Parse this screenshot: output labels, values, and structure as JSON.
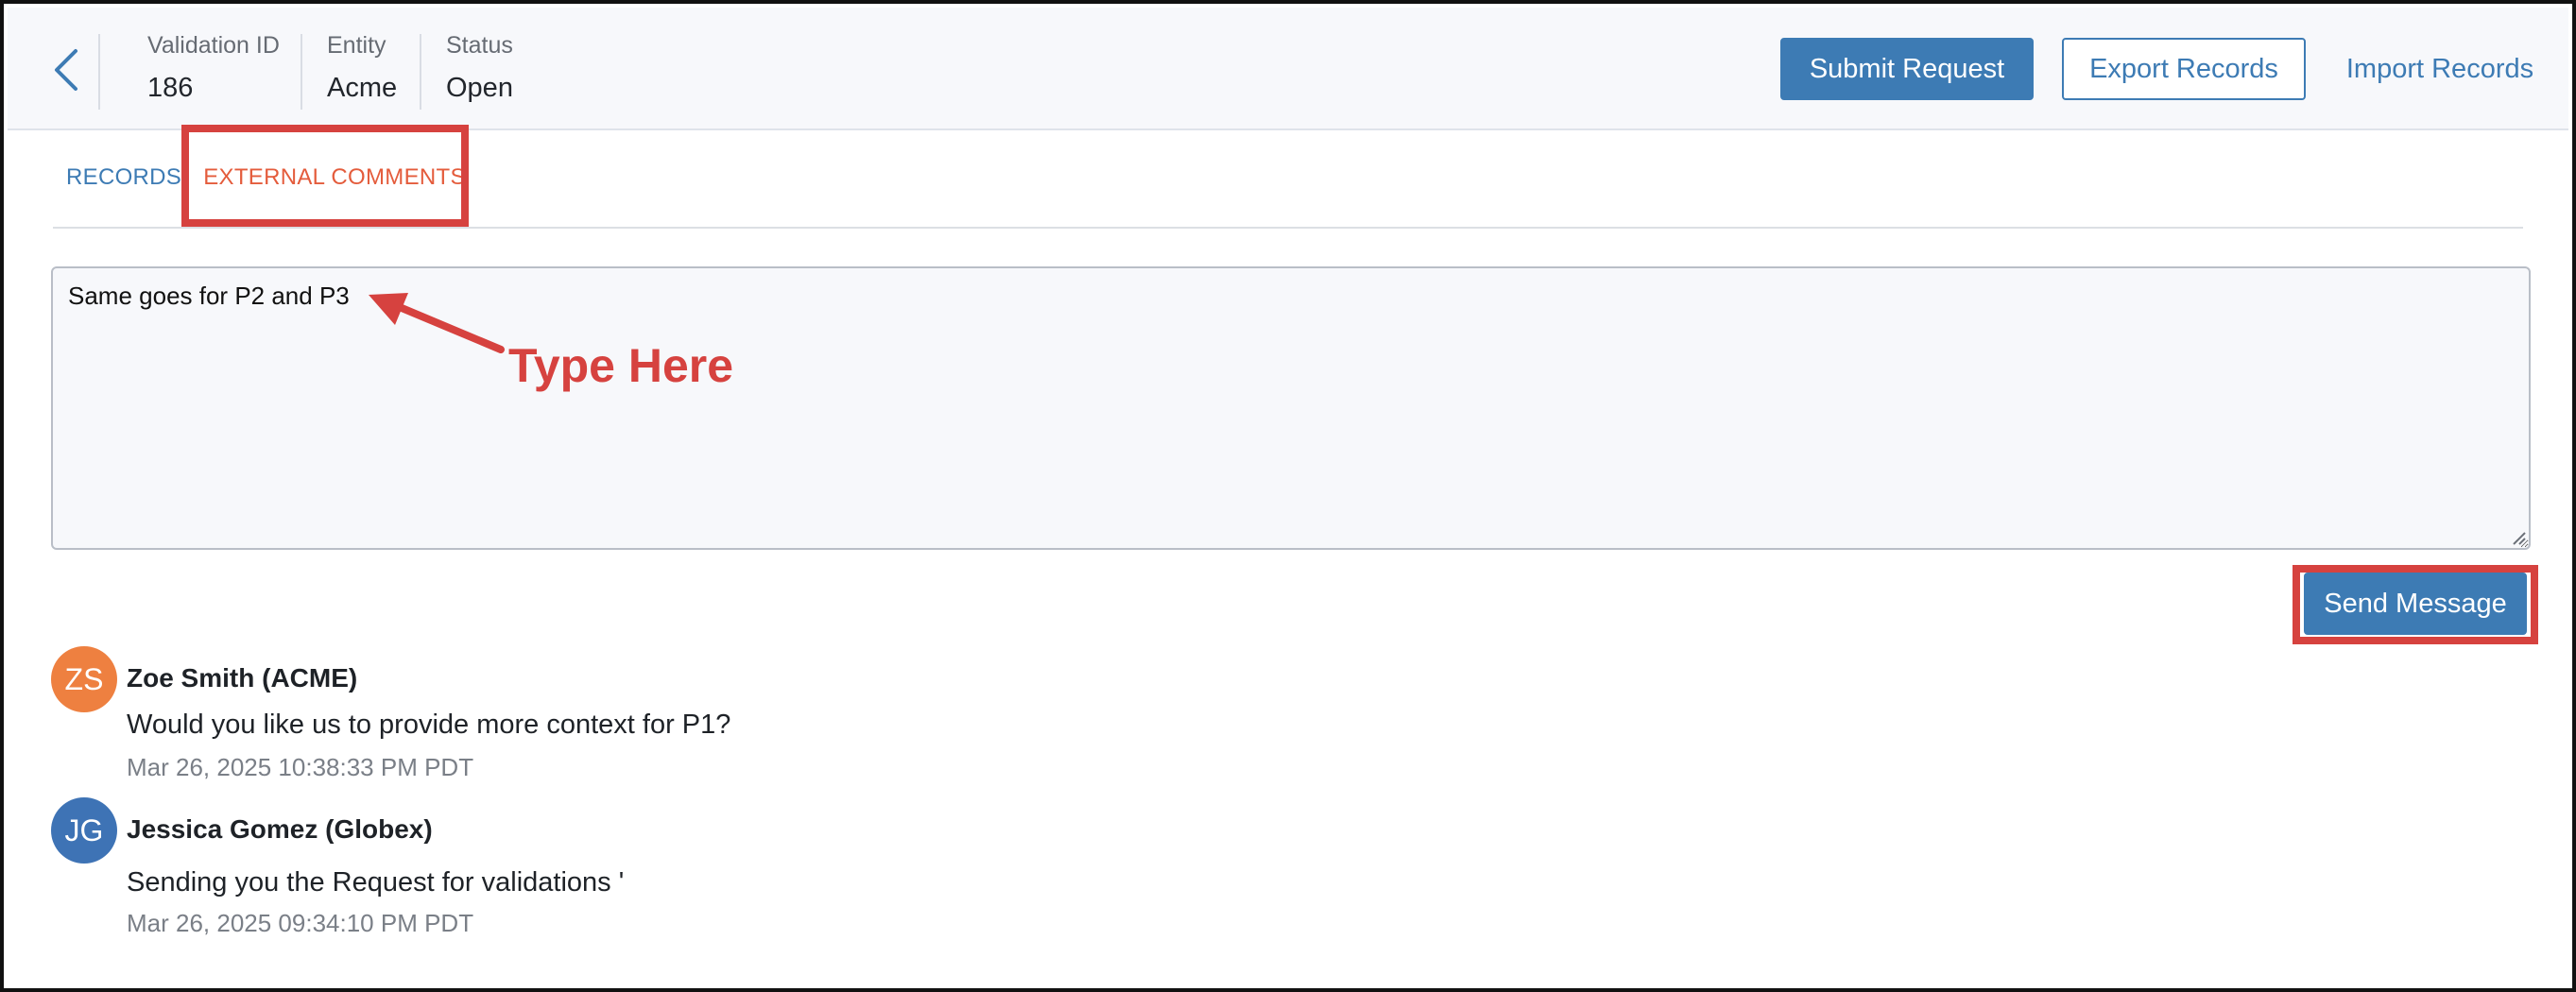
{
  "header": {
    "back_icon": "chevron-left-icon",
    "fields": [
      {
        "label": "Validation ID",
        "value": "186"
      },
      {
        "label": "Entity",
        "value": "Acme"
      },
      {
        "label": "Status",
        "value": "Open"
      }
    ],
    "submit_label": "Submit Request",
    "export_label": "Export Records",
    "import_label": "Import Records"
  },
  "tabs": {
    "records": "RECORDS",
    "external_comments": "EXTERNAL COMMENTS",
    "active": "external_comments"
  },
  "comment_input": {
    "value": "Same goes for P2 and P3"
  },
  "annotation": {
    "text": "Type Here"
  },
  "send_label": "Send Message",
  "messages": [
    {
      "initials": "ZS",
      "author": "Zoe Smith (ACME)",
      "text": "Would you like us to provide more context for P1?",
      "time": "Mar 26, 2025 10:38:33 PM PDT",
      "avatar_color": "#ee8040"
    },
    {
      "initials": "JG",
      "author": "Jessica Gomez (Globex)",
      "text": "Sending you the Request for validations '",
      "time": "Mar 26, 2025 09:34:10 PM PDT",
      "avatar_color": "#3e73b5"
    }
  ],
  "colors": {
    "primary": "#3d7bb4",
    "annotation_red": "#d6423f",
    "active_tab": "#e45c3c"
  }
}
